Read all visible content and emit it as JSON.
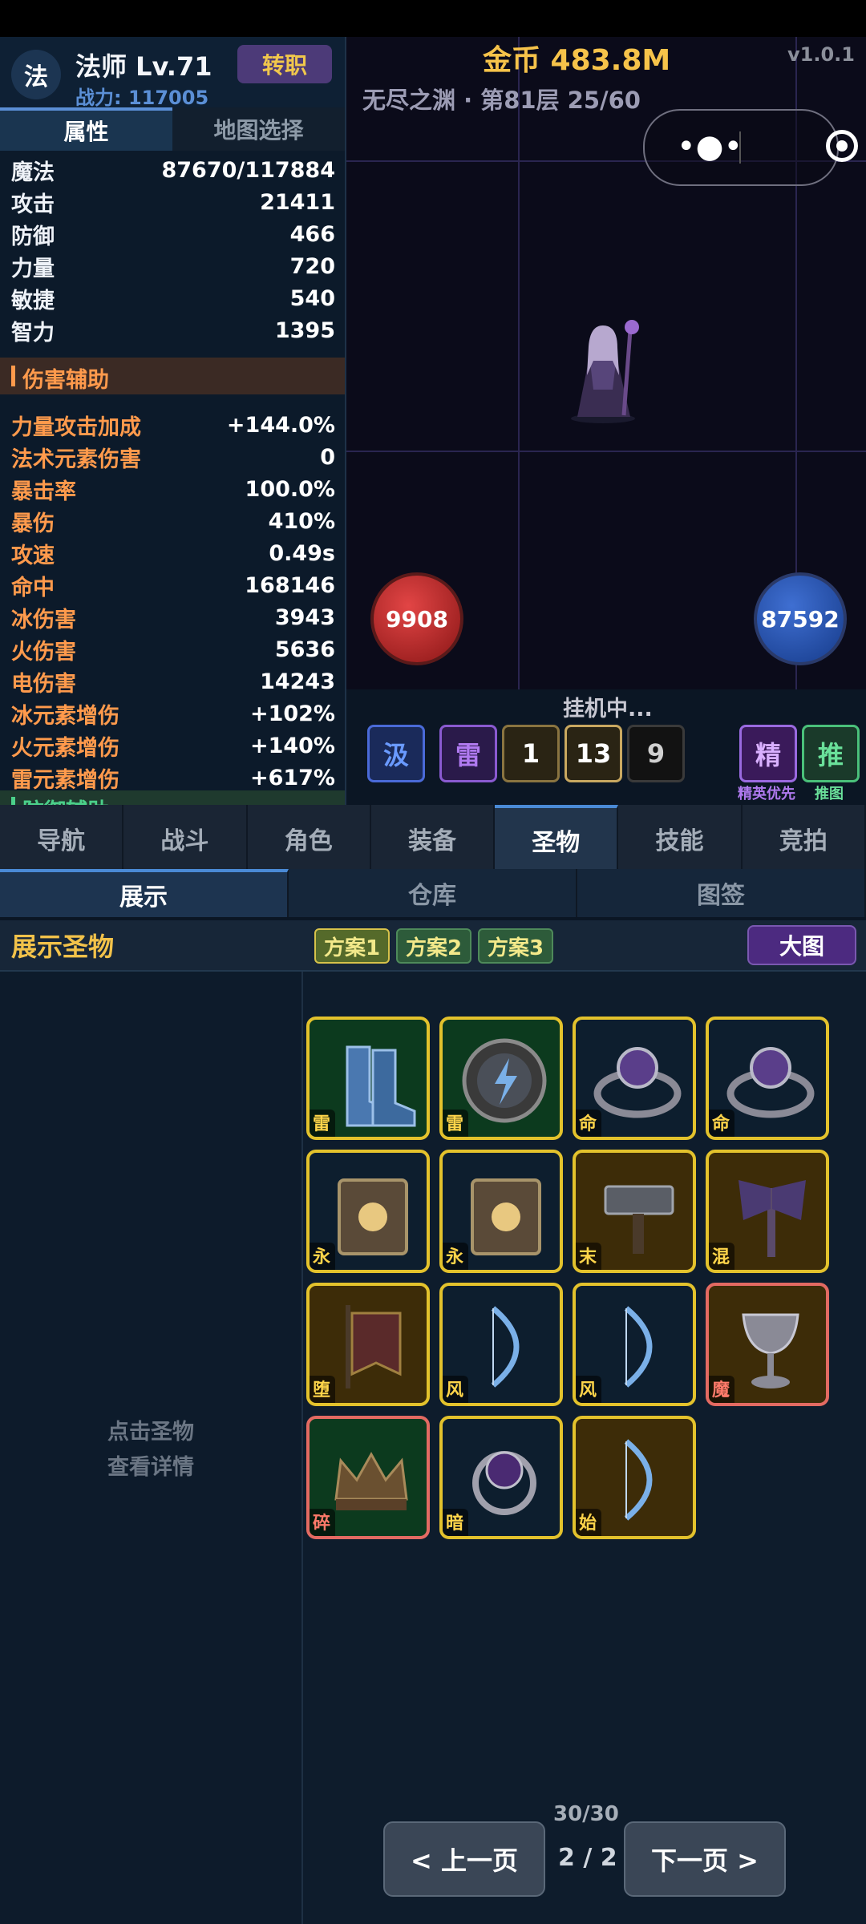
{
  "character": {
    "class_glyph": "法",
    "name": "法师 Lv.71",
    "power": "战力: 117005",
    "transfer_label": "转职"
  },
  "left_tabs": [
    "属性",
    "地图选择"
  ],
  "stats": [
    {
      "label": "魔法",
      "value": "87670/117884"
    },
    {
      "label": "攻击",
      "value": "21411"
    },
    {
      "label": "防御",
      "value": "466"
    },
    {
      "label": "力量",
      "value": "720"
    },
    {
      "label": "敏捷",
      "value": "540"
    },
    {
      "label": "智力",
      "value": "1395"
    }
  ],
  "damage_section": "伤害辅助",
  "damage_stats": [
    {
      "label": "力量攻击加成",
      "value": "+144.0%"
    },
    {
      "label": "法术元素伤害",
      "value": "0"
    },
    {
      "label": "暴击率",
      "value": "100.0%"
    },
    {
      "label": "暴伤",
      "value": "410%"
    },
    {
      "label": "攻速",
      "value": "0.49s"
    },
    {
      "label": "命中",
      "value": "168146"
    },
    {
      "label": "冰伤害",
      "value": "3943"
    },
    {
      "label": "火伤害",
      "value": "5636"
    },
    {
      "label": "电伤害",
      "value": "14243"
    },
    {
      "label": "冰元素增伤",
      "value": "+102%"
    },
    {
      "label": "火元素增伤",
      "value": "+140%"
    },
    {
      "label": "雷元素增伤",
      "value": "+617%"
    }
  ],
  "defense_section": "防御辅助",
  "game": {
    "gold": "金币 483.8M",
    "version": "v1.0.1",
    "floor": "无尽之渊 · 第81层  25/60",
    "hp": "9908",
    "mp": "87592",
    "status": "挂机中...",
    "skills": [
      "汲",
      "雷",
      "1",
      "13",
      "9",
      "精",
      "推"
    ],
    "elite_priority": "精英优先",
    "push_map": "推图"
  },
  "main_nav": [
    "导航",
    "战斗",
    "角色",
    "装备",
    "圣物",
    "技能",
    "竞拍"
  ],
  "sub_tabs": [
    "展示",
    "仓库",
    "图签"
  ],
  "relic_header": {
    "title": "展示圣物",
    "plans": [
      "方案1",
      "方案2",
      "方案3"
    ],
    "big_map": "大图"
  },
  "detail_hint": [
    "点击圣物",
    "查看详情"
  ],
  "relics": [
    {
      "tag": "雷",
      "icon": "boots-icon",
      "bg": "green",
      "border": "gold"
    },
    {
      "tag": "雷",
      "icon": "lightning-shield-icon",
      "bg": "green",
      "border": "gold"
    },
    {
      "tag": "命",
      "icon": "gem-ring-icon",
      "bg": "dark",
      "border": "gold"
    },
    {
      "tag": "命",
      "icon": "gem-ring-icon",
      "bg": "dark",
      "border": "gold"
    },
    {
      "tag": "永",
      "icon": "tome-icon",
      "bg": "dark",
      "border": "gold"
    },
    {
      "tag": "永",
      "icon": "tome-icon",
      "bg": "dark",
      "border": "gold"
    },
    {
      "tag": "末",
      "icon": "hammer-icon",
      "bg": "gold",
      "border": "gold"
    },
    {
      "tag": "混",
      "icon": "axe-icon",
      "bg": "gold",
      "border": "gold"
    },
    {
      "tag": "堕",
      "icon": "banner-icon",
      "bg": "gold",
      "border": "gold"
    },
    {
      "tag": "风",
      "icon": "bow-icon",
      "bg": "dark",
      "border": "gold"
    },
    {
      "tag": "风",
      "icon": "bow-icon",
      "bg": "dark",
      "border": "gold"
    },
    {
      "tag": "魔",
      "icon": "chalice-icon",
      "bg": "gold",
      "border": "red"
    },
    {
      "tag": "碎",
      "icon": "crown-icon",
      "bg": "green",
      "border": "red"
    },
    {
      "tag": "暗",
      "icon": "dark-ring-icon",
      "bg": "dark",
      "border": "gold"
    },
    {
      "tag": "始",
      "icon": "bow-icon",
      "bg": "gold",
      "border": "gold"
    }
  ],
  "pagination": {
    "count": "30/30",
    "prev": "< 上一页",
    "page": "2 / 2",
    "next": "下一页 >"
  }
}
